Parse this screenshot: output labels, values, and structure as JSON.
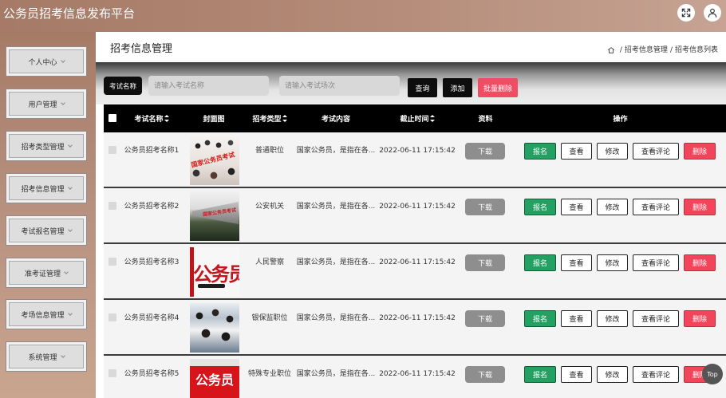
{
  "app": {
    "title": "公务员招考信息发布平台"
  },
  "header": {
    "icons": [
      "fullscreen-icon",
      "user-icon"
    ]
  },
  "sidebar": {
    "items": [
      {
        "label": "个人中心"
      },
      {
        "label": "用户管理"
      },
      {
        "label": "招考类型管理"
      },
      {
        "label": "招考信息管理"
      },
      {
        "label": "考试报名管理"
      },
      {
        "label": "准考证管理"
      },
      {
        "label": "考场信息管理"
      },
      {
        "label": "系统管理"
      }
    ]
  },
  "page": {
    "title": "招考信息管理",
    "breadcrumb": {
      "icon": "home-icon",
      "separator": "/",
      "items": [
        "招考信息管理",
        "招考信息列表"
      ]
    }
  },
  "search": {
    "field_label": "考试名称",
    "name_placeholder": "请输入考试名称",
    "session_placeholder": "请输入考试场次",
    "query_label": "查询",
    "add_label": "添加",
    "batch_delete_label": "批量删除"
  },
  "table": {
    "columns": [
      {
        "label": "考试名称",
        "sortable": true
      },
      {
        "label": "封面图",
        "sortable": false
      },
      {
        "label": "招考类型",
        "sortable": true
      },
      {
        "label": "考试内容",
        "sortable": false
      },
      {
        "label": "截止时间",
        "sortable": true
      },
      {
        "label": "资料",
        "sortable": false
      },
      {
        "label": "操作",
        "sortable": false
      }
    ],
    "actions": {
      "download": "下载",
      "apply": "报名",
      "view": "查看",
      "edit": "修改",
      "comments": "查看评论",
      "delete": "删除"
    },
    "rows": [
      {
        "name": "公务员招考名称1",
        "cover_text": "国家公务员考试",
        "type": "普通职位",
        "content": "国家公务员，是指在各...",
        "deadline": "2022-06-11 17:15:42"
      },
      {
        "name": "公务员招考名称2",
        "cover_text": "国家公务员考试",
        "type": "公安机关",
        "content": "国家公务员，是指在各...",
        "deadline": "2022-06-11 17:15:42"
      },
      {
        "name": "公务员招考名称3",
        "cover_text": "公务员",
        "type": "人民警察",
        "content": "国家公务员，是指在各...",
        "deadline": "2022-06-11 17:15:42"
      },
      {
        "name": "公务员招考名称4",
        "type": "银保监职位",
        "content": "国家公务员，是指在各...",
        "deadline": "2022-06-11 17:15:42"
      },
      {
        "name": "公务员招考名称5",
        "cover_text": "公务员",
        "type": "特殊专业职位",
        "content": "国家公务员，是指在各...",
        "deadline": "2022-06-11 17:15:42"
      }
    ]
  },
  "back_to_top": {
    "label": "Top"
  },
  "colors": {
    "header_bg": "#a57a66",
    "dark_button": "#0d0d0d",
    "danger": "#f0455a",
    "success": "#23a062",
    "muted_button": "#8e8e8e"
  }
}
